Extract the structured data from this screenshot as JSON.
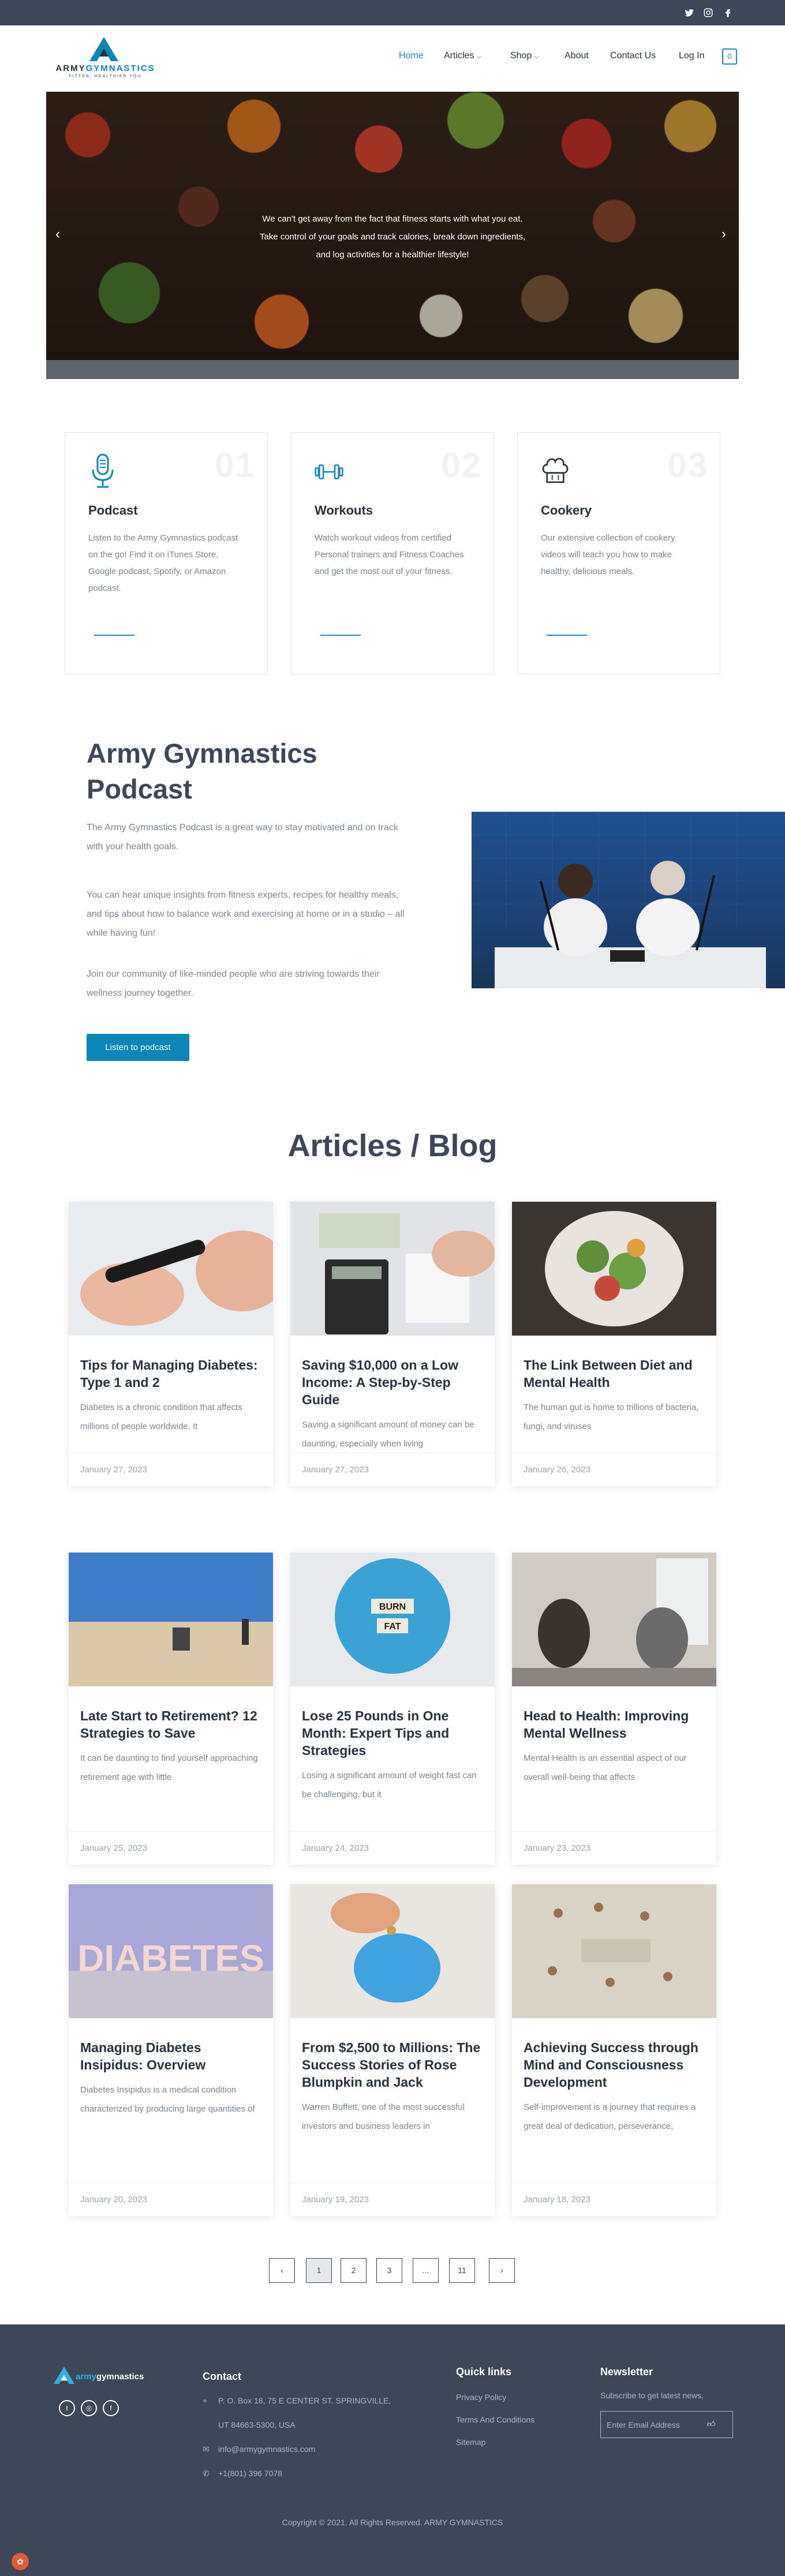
{
  "topbar": {
    "social": [
      {
        "icon": "twitter-icon"
      },
      {
        "icon": "instagram-icon"
      },
      {
        "icon": "facebook-icon"
      }
    ]
  },
  "header": {
    "logo_part1": "ARMY",
    "logo_part2": "GYMNASTICS",
    "logo_tagline": "FITTER, HEALTHIER YOU",
    "nav": [
      {
        "label": "Home",
        "active": true
      },
      {
        "label": "Articles",
        "dropdown": true
      },
      {
        "label": "Shop",
        "dropdown": true
      },
      {
        "label": "About"
      },
      {
        "label": "Contact Us"
      },
      {
        "label": "Log In"
      }
    ],
    "cart_count": "0"
  },
  "hero": {
    "text_line1": "We can't get away from the fact that fitness starts with what you eat.",
    "text_line2": "Take control of your goals and track calories, break down ingredients,",
    "text_line3": "and log activities for a healthier lifestyle!",
    "prev": "‹",
    "next": "›"
  },
  "features": [
    {
      "num": "01",
      "icon": "microphone-icon",
      "title": "Podcast",
      "desc": "Listen to the Army Gymnastics podcast on the go! Find it on iTunes Store, Google podcast, Spotify, or Amazon podcast."
    },
    {
      "num": "02",
      "icon": "dumbbell-icon",
      "title": "Workouts",
      "desc": "Watch workout videos from certified Personal trainers and Fitness Coaches and get the most out of your fitness."
    },
    {
      "num": "03",
      "icon": "chef-hat-icon",
      "title": "Cookery",
      "desc": "Our extensive collection of cookery videos will teach you how to make healthy, delicious meals."
    }
  ],
  "podcast": {
    "title": "Army Gymnastics Podcast",
    "p1": "The Army Gymnastics Podcast is a great way to stay motivated and on track with your health goals.",
    "p2": "You can hear unique insights from fitness experts, recipes for healthy meals, and tips about how to balance work and exercising at home or in a studio – all while having fun!",
    "p3": "Join our community of like-minded people who are striving towards their wellness journey together.",
    "button": "Listen to podcast"
  },
  "articles": {
    "title": "Articles / Blog",
    "items": [
      {
        "title": "Tips for Managing Diabetes: Type 1 and 2",
        "excerpt": "Diabetes is a chronic condition that affects millions of people worldwide. It",
        "date": "January 27, 2023"
      },
      {
        "title": "Saving $10,000 on a Low Income: A Step-by-Step Guide",
        "excerpt": "Saving a significant amount of money can be daunting, especially when living",
        "date": "January 27, 2023"
      },
      {
        "title": "The Link Between Diet and Mental Health",
        "excerpt": "The human gut is home to trillions of bacteria, fungi, and viruses",
        "date": "January 26, 2023"
      },
      {
        "title": "Late Start to Retirement? 12 Strategies to Save",
        "excerpt": "It can be daunting to find yourself approaching retirement age with little",
        "date": "January 25, 2023"
      },
      {
        "title": "Lose 25 Pounds in One Month: Expert Tips and Strategies",
        "excerpt": "Losing a significant amount of weight fast can be challenging, but it",
        "date": "January 24, 2023"
      },
      {
        "title": "Head to Health: Improving Mental Wellness",
        "excerpt": "Mental Health is an essential aspect of our overall well-being that affects",
        "date": "January 23, 2023"
      },
      {
        "title": "Managing Diabetes Insipidus: Overview",
        "excerpt": "Diabetes Insipidus is a medical condition characterized by producing large quantities of",
        "date": "January 20, 2023"
      },
      {
        "title": "From $2,500 to Millions: The Success Stories of Rose Blumpkin and Jack",
        "excerpt": "Warren Buffett, one of the most successful investors and business leaders in",
        "date": "January 19, 2023"
      },
      {
        "title": "Achieving Success through Mind and Consciousness Development",
        "excerpt": "Self-improvement is a journey that requires a great deal of dedication, perseverance,",
        "date": "January 18, 2023"
      }
    ],
    "image_text": {
      "burn": "BURN",
      "fat": "FAT",
      "diabetes": "DIABETES"
    }
  },
  "pagination": {
    "prev": "‹",
    "pages": [
      "1",
      "2",
      "3",
      "...",
      "11"
    ],
    "current": "1",
    "next": "›"
  },
  "footer": {
    "logo_part1": "army",
    "logo_part2": "gymnastics",
    "contact_title": "Contact",
    "address1": "P. O. Box 18, 75 E CENTER ST. SPRINGVILLE,",
    "address2": "UT 84663-5300, USA",
    "email": "info@armygymnastics.com",
    "phone": "+1(801) 396 7078",
    "quick_title": "Quick links",
    "links": [
      "Privacy Policy",
      "Terms And Conditions",
      "Sitemap"
    ],
    "newsletter_title": "Newsletter",
    "newsletter_text": "Subscribe to get latest news,",
    "newsletter_placeholder": "Enter Email Address",
    "copyright": "Copyright © 2021. All Rights Reserved. ARMY GYMNASTICS"
  },
  "colors": {
    "brand": "#0b86b9",
    "dark": "#3d4757"
  }
}
